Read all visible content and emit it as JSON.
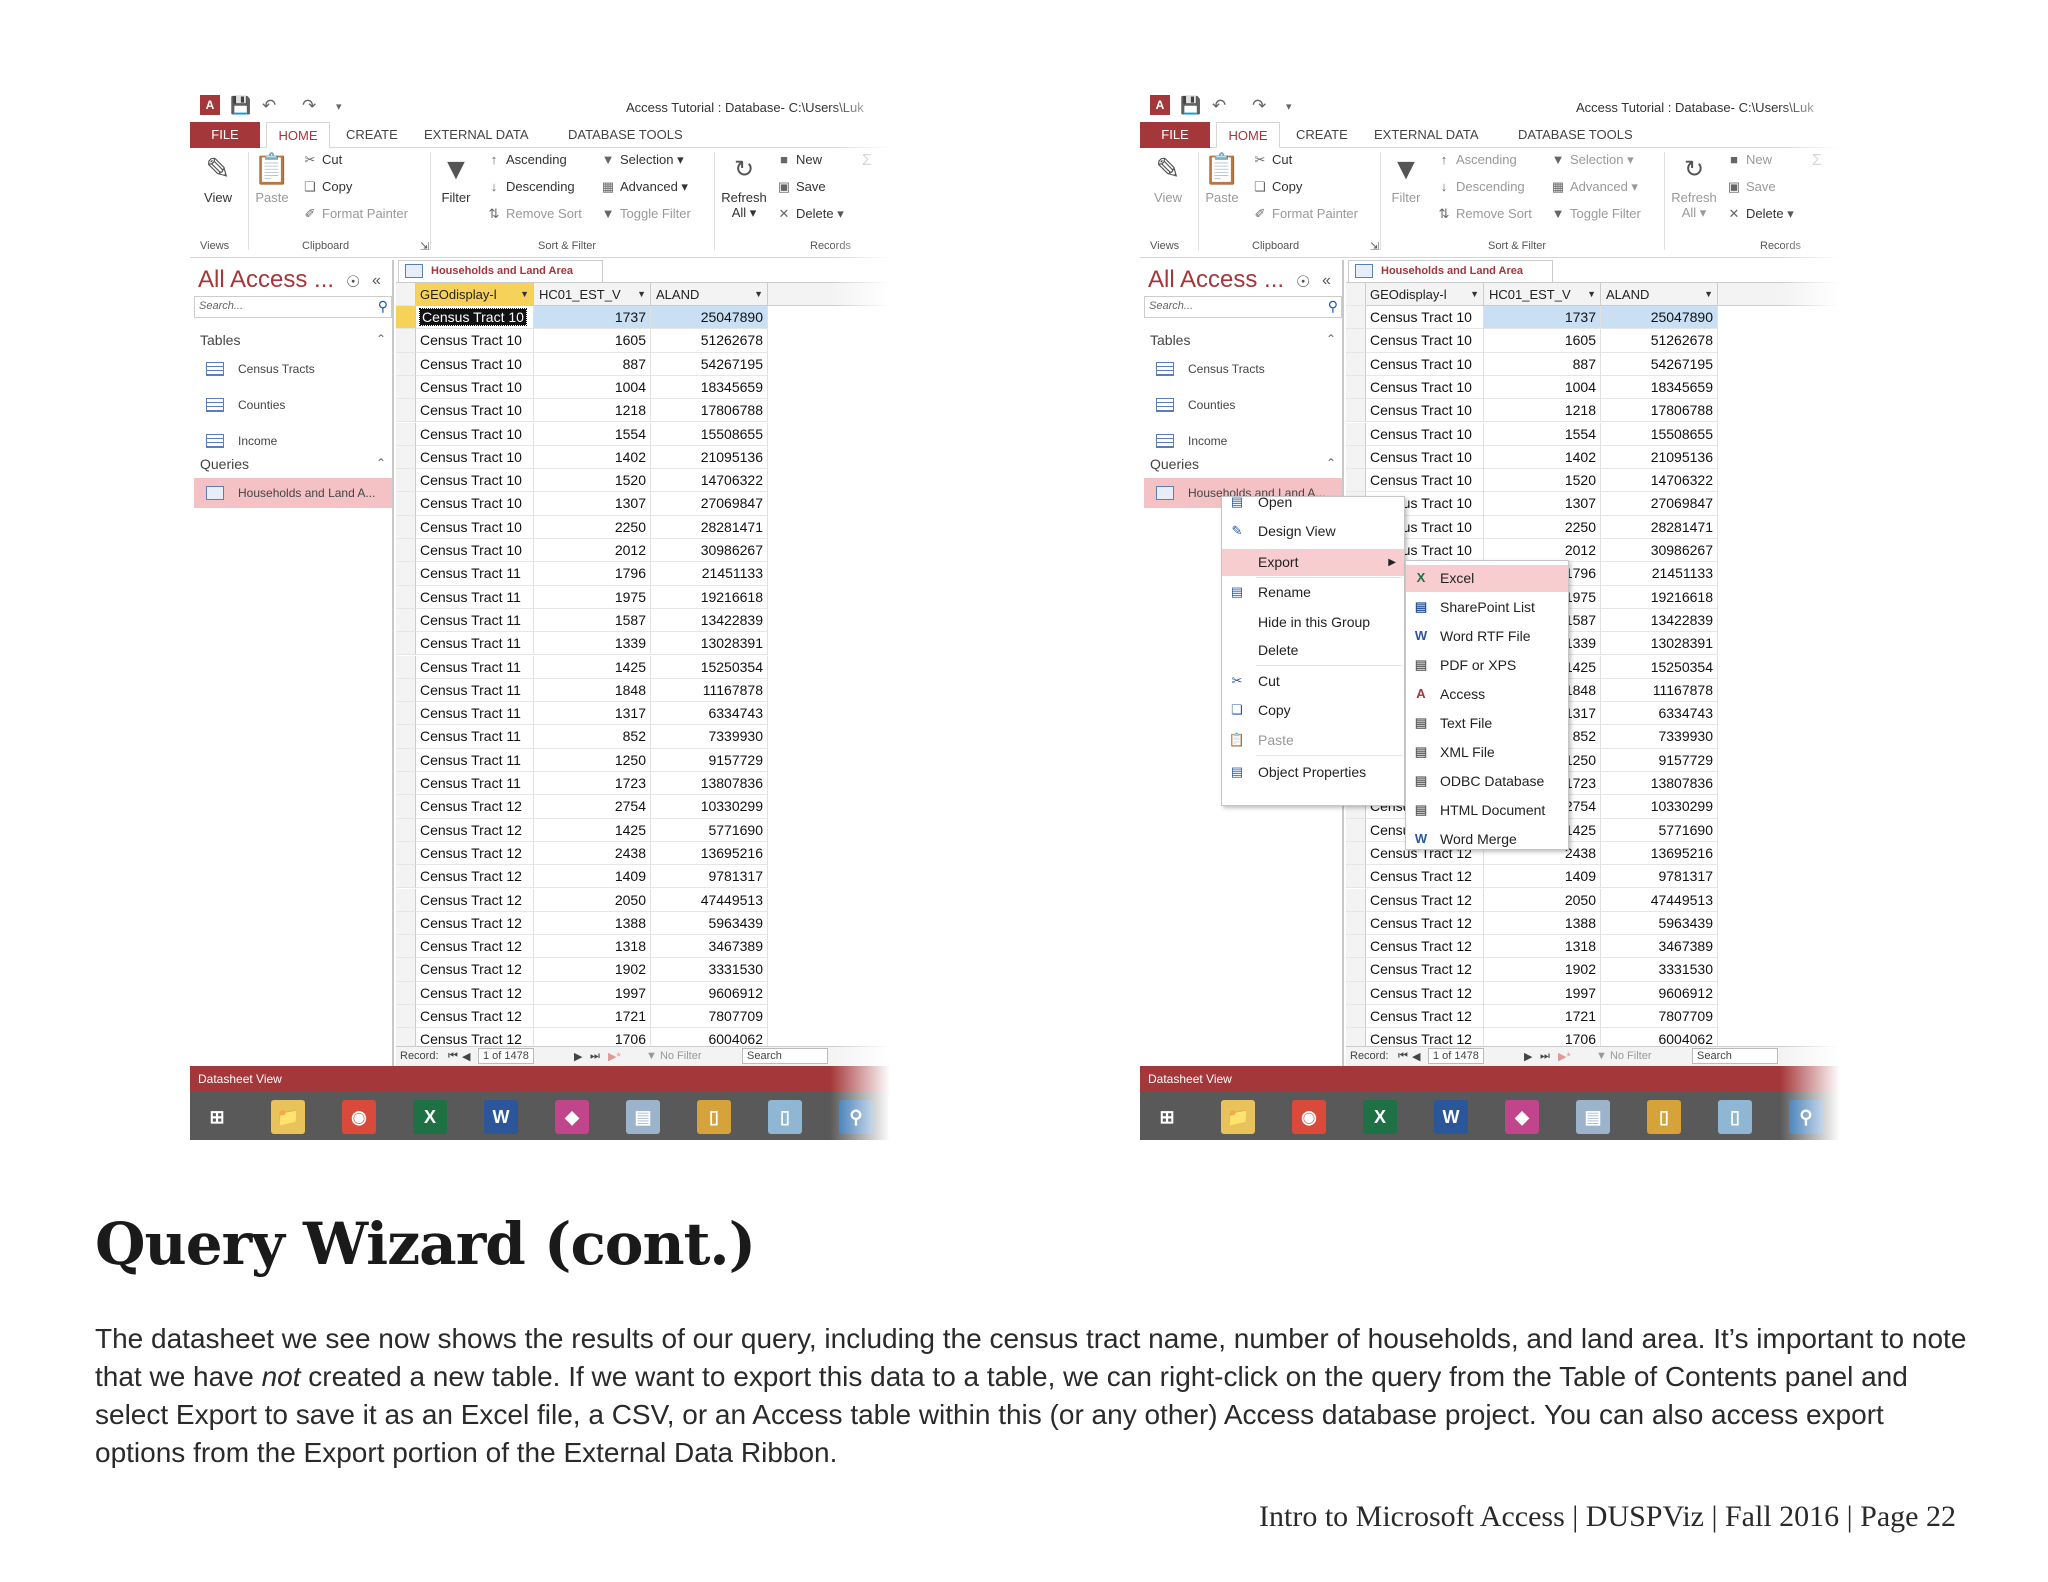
{
  "app": {
    "window_title": "Access Tutorial : Database- C:\\Users\\Luk",
    "tabs": [
      "FILE",
      "HOME",
      "CREATE",
      "EXTERNAL DATA",
      "DATABASE TOOLS"
    ],
    "ribbon": {
      "view": "View",
      "paste": "Paste",
      "cut": "Cut",
      "copy": "Copy",
      "format_painter": "Format Painter",
      "filter": "Filter",
      "ascending": "Ascending",
      "descending": "Descending",
      "remove_sort": "Remove Sort",
      "selection": "Selection",
      "advanced": "Advanced",
      "toggle_filter": "Toggle Filter",
      "refresh": "Refresh",
      "refresh_all": "All",
      "new": "New",
      "save": "Save",
      "delete": "Delete",
      "group_views": "Views",
      "group_clipboard": "Clipboard",
      "group_sort_filter": "Sort & Filter",
      "group_records": "Records"
    },
    "nav": {
      "title": "All Access ...",
      "search_placeholder": "Search...",
      "tables_header": "Tables",
      "tables": [
        "Census Tracts",
        "Counties",
        "Income"
      ],
      "queries_header": "Queries",
      "queries": [
        "Households and Land A..."
      ]
    },
    "document_tab": "Households and Land Area",
    "columns": [
      "GEOdisplay-l",
      "HC01_EST_V",
      "ALAND"
    ],
    "rows": [
      [
        "Census Tract 10",
        "1737",
        "25047890"
      ],
      [
        "Census Tract 10",
        "1605",
        "51262678"
      ],
      [
        "Census Tract 10",
        "887",
        "54267195"
      ],
      [
        "Census Tract 10",
        "1004",
        "18345659"
      ],
      [
        "Census Tract 10",
        "1218",
        "17806788"
      ],
      [
        "Census Tract 10",
        "1554",
        "15508655"
      ],
      [
        "Census Tract 10",
        "1402",
        "21095136"
      ],
      [
        "Census Tract 10",
        "1520",
        "14706322"
      ],
      [
        "Census Tract 10",
        "1307",
        "27069847"
      ],
      [
        "Census Tract 10",
        "2250",
        "28281471"
      ],
      [
        "Census Tract 10",
        "2012",
        "30986267"
      ],
      [
        "Census Tract 11",
        "1796",
        "21451133"
      ],
      [
        "Census Tract 11",
        "1975",
        "19216618"
      ],
      [
        "Census Tract 11",
        "1587",
        "13422839"
      ],
      [
        "Census Tract 11",
        "1339",
        "13028391"
      ],
      [
        "Census Tract 11",
        "1425",
        "15250354"
      ],
      [
        "Census Tract 11",
        "1848",
        "11167878"
      ],
      [
        "Census Tract 11",
        "1317",
        "6334743"
      ],
      [
        "Census Tract 11",
        "852",
        "7339930"
      ],
      [
        "Census Tract 11",
        "1250",
        "9157729"
      ],
      [
        "Census Tract 11",
        "1723",
        "13807836"
      ],
      [
        "Census Tract 12",
        "2754",
        "10330299"
      ],
      [
        "Census Tract 12",
        "1425",
        "5771690"
      ],
      [
        "Census Tract 12",
        "2438",
        "13695216"
      ],
      [
        "Census Tract 12",
        "1409",
        "9781317"
      ],
      [
        "Census Tract 12",
        "2050",
        "47449513"
      ],
      [
        "Census Tract 12",
        "1388",
        "5963439"
      ],
      [
        "Census Tract 12",
        "1318",
        "3467389"
      ],
      [
        "Census Tract 12",
        "1902",
        "3331530"
      ],
      [
        "Census Tract 12",
        "1997",
        "9606912"
      ],
      [
        "Census Tract 12",
        "1721",
        "7807709"
      ],
      [
        "Census Tract 12",
        "1706",
        "6004062"
      ]
    ],
    "record_nav": {
      "label": "Record:",
      "position": "1 of 1478",
      "no_filter": "No Filter",
      "search": "Search"
    },
    "status_bar": "Datasheet View",
    "taskbar_icons": [
      "start-icon",
      "file-explorer-icon",
      "chrome-icon",
      "excel-icon",
      "word-icon",
      "app-icon",
      "calculator-icon",
      "folder-icon",
      "notepad-icon",
      "magnifier-icon"
    ]
  },
  "context_menu": {
    "items": [
      "Open",
      "Design View",
      "Export",
      "Rename",
      "Hide in this Group",
      "Delete",
      "Cut",
      "Copy",
      "Paste",
      "Object Properties"
    ],
    "disabled": [
      "Paste"
    ],
    "highlighted": "Export"
  },
  "export_submenu": {
    "items": [
      "Excel",
      "SharePoint List",
      "Word RTF File",
      "PDF or XPS",
      "Access",
      "Text File",
      "XML File",
      "ODBC Database",
      "HTML Document",
      "Word Merge"
    ],
    "highlighted": "Excel"
  },
  "page": {
    "heading": "Query Wizard (cont.)",
    "body_1": "The datasheet we see now shows the results of our query, including the census tract name, number of households, and land area. It’s important to note that we have ",
    "body_em": "not",
    "body_2": " created a new table. If we want to export this data to a table, we can right-click on the query from the Table of Contents panel and select Export to save it as an Excel file, a CSV, or an Access table within this (or any other) Access database project. You can also access export options from the Export portion of the External Data Ribbon.",
    "footer": "Intro to Microsoft Access | DUSPViz | Fall 2016 | Page 22"
  }
}
